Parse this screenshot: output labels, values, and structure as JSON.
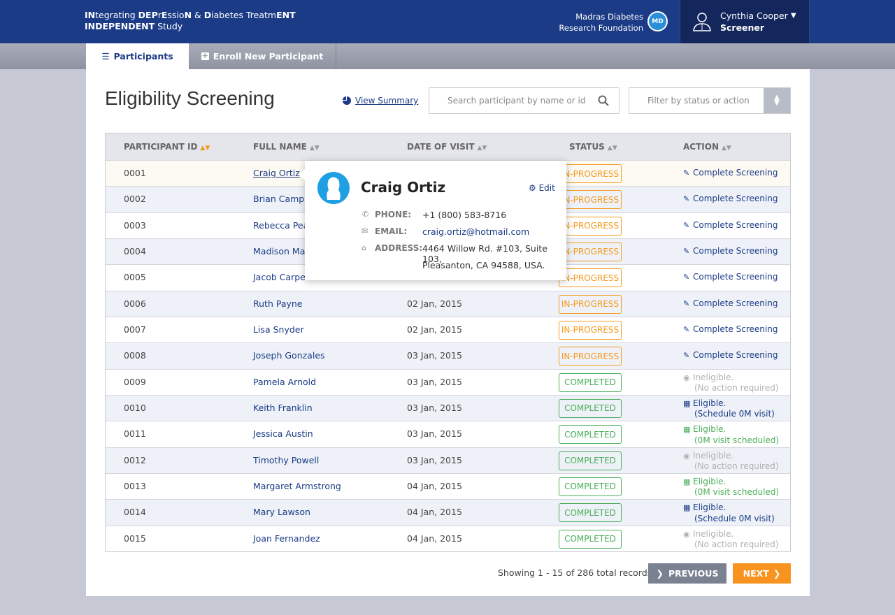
{
  "header": {
    "title_line1": [
      {
        "text": "IN",
        "bold": true
      },
      {
        "text": "tegrating ",
        "bold": false
      },
      {
        "text": "DEP",
        "bold": true
      },
      {
        "text": "r",
        "bold": false
      },
      {
        "text": "E",
        "bold": true
      },
      {
        "text": "ssio",
        "bold": false
      },
      {
        "text": "N",
        "bold": true
      },
      {
        "text": " & ",
        "bold": false
      },
      {
        "text": "D",
        "bold": true
      },
      {
        "text": "iabetes Treatm",
        "bold": false
      },
      {
        "text": "ENT",
        "bold": true
      }
    ],
    "title_line2_bold": "INDEPENDENT",
    "title_line2_rest": " Study",
    "org_line1": "Madras Diabetes",
    "org_line2": "Research Foundation",
    "org_logo": "MDRF",
    "user_name": "Cynthia Cooper",
    "user_role": "Screener"
  },
  "tabs": [
    {
      "label": "Participants",
      "icon": "list-icon",
      "active": true
    },
    {
      "label": "Enroll New Participant",
      "icon": "plus-square-icon",
      "active": false
    }
  ],
  "page": {
    "title": "Eligibility Screening",
    "view_summary": "View Summary",
    "search_placeholder": "Search participant by name or id",
    "filter_placeholder": "Filter by status or action"
  },
  "table": {
    "columns": [
      "PARTICIPANT ID",
      "FULL NAME",
      "DATE OF VISIT",
      "STATUS",
      "ACTION"
    ],
    "rows": [
      {
        "id": "0001",
        "name": "Craig Ortiz",
        "date": "",
        "status": "IN-PROGRESS",
        "action": "Complete Screening",
        "sub": "",
        "kind": "edit"
      },
      {
        "id": "0002",
        "name": "Brian Campb",
        "date": "",
        "status": "IN-PROGRESS",
        "action": "Complete Screening",
        "sub": "",
        "kind": "edit"
      },
      {
        "id": "0003",
        "name": "Rebecca Pea",
        "date": "",
        "status": "IN-PROGRESS",
        "action": "Complete Screening",
        "sub": "",
        "kind": "edit"
      },
      {
        "id": "0004",
        "name": "Madison Ma",
        "date": "",
        "status": "IN-PROGRESS",
        "action": "Complete Screening",
        "sub": "",
        "kind": "edit"
      },
      {
        "id": "0005",
        "name": "Jacob Carper",
        "date": "",
        "status": "IN-PROGRESS",
        "action": "Complete Screening",
        "sub": "",
        "kind": "edit"
      },
      {
        "id": "0006",
        "name": "Ruth Payne",
        "date": "02 Jan, 2015",
        "status": "IN-PROGRESS",
        "action": "Complete Screening",
        "sub": "",
        "kind": "edit"
      },
      {
        "id": "0007",
        "name": "Lisa Snyder",
        "date": "02 Jan, 2015",
        "status": "IN-PROGRESS",
        "action": "Complete Screening",
        "sub": "",
        "kind": "edit"
      },
      {
        "id": "0008",
        "name": "Joseph Gonzales",
        "date": "03 Jan, 2015",
        "status": "IN-PROGRESS",
        "action": "Complete Screening",
        "sub": "",
        "kind": "edit"
      },
      {
        "id": "0009",
        "name": "Pamela Arnold",
        "date": "03 Jan, 2015",
        "status": "COMPLETED",
        "action": "Ineligible.",
        "sub": "(No action required)",
        "kind": "ineligible"
      },
      {
        "id": "0010",
        "name": "Keith Franklin",
        "date": "03 Jan, 2015",
        "status": "COMPLETED",
        "action": "Eligible.",
        "sub": "(Schedule 0M visit)",
        "kind": "schedule"
      },
      {
        "id": "0011",
        "name": "Jessica Austin",
        "date": "03 Jan, 2015",
        "status": "COMPLETED",
        "action": "Eligible.",
        "sub": "(0M visit scheduled)",
        "kind": "scheduled"
      },
      {
        "id": "0012",
        "name": "Timothy Powell",
        "date": "03 Jan, 2015",
        "status": "COMPLETED",
        "action": "Ineligible.",
        "sub": "(No action required)",
        "kind": "ineligible"
      },
      {
        "id": "0013",
        "name": "Margaret Armstrong",
        "date": "04 Jan, 2015",
        "status": "COMPLETED",
        "action": "Eligible.",
        "sub": "(0M visit scheduled)",
        "kind": "scheduled"
      },
      {
        "id": "0014",
        "name": "Mary Lawson",
        "date": "04 Jan, 2015",
        "status": "COMPLETED",
        "action": "Eligible.",
        "sub": "(Schedule 0M visit)",
        "kind": "schedule"
      },
      {
        "id": "0015",
        "name": "Joan Fernandez",
        "date": "04 Jan, 2015",
        "status": "COMPLETED",
        "action": "Ineligible.",
        "sub": "(No action required)",
        "kind": "ineligible"
      }
    ]
  },
  "popover": {
    "name": "Craig Ortiz",
    "edit": "Edit",
    "phone_label": "PHONE:",
    "phone": "+1 (800) 583-8716",
    "email_label": "EMAIL:",
    "email": "craig.ortiz@hotmail.com",
    "address_label": "ADDRESS:",
    "address_line1": "4464 Willow Rd. #103, Suite 103,",
    "address_line2": "Pleasanton, CA 94588, USA."
  },
  "pagination": {
    "summary": "Showing 1 - 15 of 286 total records",
    "previous": "PREVIOUS",
    "next": "NEXT"
  },
  "colors": {
    "navy": "#1b3b86",
    "orange": "#f59a1d",
    "green": "#4cae5a",
    "muted": "#b0b0b0"
  }
}
